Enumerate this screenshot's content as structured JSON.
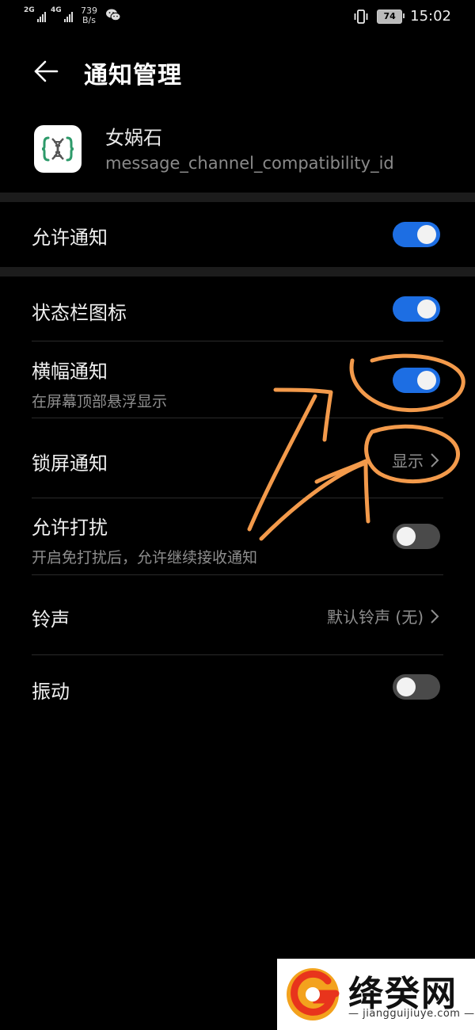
{
  "statusbar": {
    "sim1": "2G",
    "sim2": "4G",
    "speed_value": "739",
    "speed_unit": "B/s",
    "battery": "74",
    "time": "15:02"
  },
  "header": {
    "title": "通知管理"
  },
  "app": {
    "name": "女娲石",
    "channel_id": "message_channel_compatibility_id"
  },
  "settings": {
    "allow_notifications": {
      "label": "允许通知",
      "on": true
    },
    "statusbar_icon": {
      "label": "状态栏图标",
      "on": true
    },
    "banner": {
      "label": "横幅通知",
      "sub": "在屏幕顶部悬浮显示",
      "on": true
    },
    "lockscreen": {
      "label": "锁屏通知",
      "value": "显示"
    },
    "dnd": {
      "label": "允许打扰",
      "sub": "开启免打扰后，允许继续接收通知",
      "on": false
    },
    "ringtone": {
      "label": "铃声",
      "value": "默认铃声 (无)"
    },
    "vibration": {
      "label": "振动",
      "on": false
    }
  },
  "colors": {
    "toggle_on": "#1d6ee3",
    "toggle_off": "#4a4a4a",
    "annotation": "#f39a4b"
  },
  "watermark": {
    "name": "绛癸网",
    "url": "— jiangguijiuye.com —"
  }
}
